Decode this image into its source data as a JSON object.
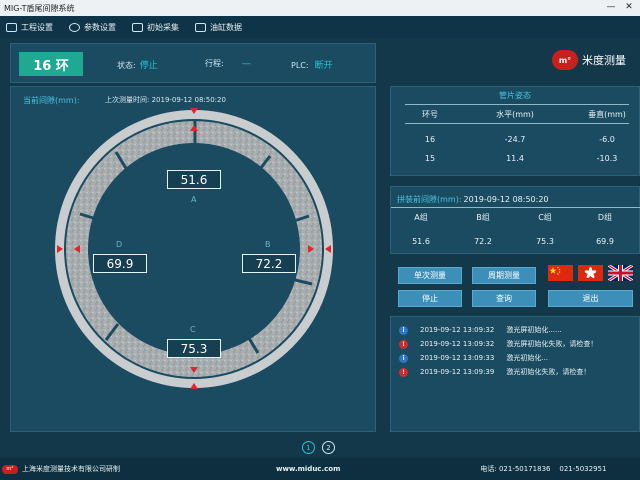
{
  "window": {
    "title": "MIG-T盾尾间隙系统",
    "minimize": "—",
    "close": "✕"
  },
  "menu": [
    {
      "label": "工程设置",
      "icon": "project-settings-icon"
    },
    {
      "label": "参数设置",
      "icon": "gear-icon"
    },
    {
      "label": "初始采集",
      "icon": "monitor-icon"
    },
    {
      "label": "油缸数据",
      "icon": "cylinder-icon"
    }
  ],
  "status": {
    "ring": "16 环",
    "state_label": "状态:",
    "state_value": "停止",
    "travel_label": "行程:",
    "travel_value": "—",
    "plc_label": "PLC:",
    "plc_value": "断开"
  },
  "logo": {
    "mark": "m°",
    "name": "米度测量"
  },
  "gap": {
    "title": "当前间隙(mm):",
    "last_time": "上次测量时间: 2019-09-12 08:50:20",
    "A": {
      "letter": "A",
      "value": "51.6"
    },
    "B": {
      "letter": "B",
      "value": "72.2"
    },
    "C": {
      "letter": "C",
      "value": "75.3"
    },
    "D": {
      "letter": "D",
      "value": "69.9"
    }
  },
  "pose": {
    "title": "管片姿态",
    "headers": [
      "环号",
      "水平(mm)",
      "垂直(mm)"
    ],
    "rows": [
      [
        "16",
        "-24.7",
        "-6.0"
      ],
      [
        "15",
        "11.4",
        "-10.3"
      ]
    ]
  },
  "assembly": {
    "title": "拼装前间隙(mm):",
    "time": "2019-09-12 08:50:20",
    "headers": [
      "A组",
      "B组",
      "C组",
      "D组"
    ],
    "values": [
      "51.6",
      "72.2",
      "75.3",
      "69.9"
    ]
  },
  "buttons": {
    "single": "单次测量",
    "periodic": "周期测量",
    "stop": "停止",
    "query": "查询",
    "exit": "退出"
  },
  "flags": {
    "cn": "china-flag-icon",
    "hk": "hongkong-flag-icon",
    "uk": "uk-flag-icon"
  },
  "log": [
    {
      "type": "info",
      "time": "2019-09-12 13:09:32",
      "msg": "激光屏初始化......"
    },
    {
      "type": "error",
      "time": "2019-09-12 13:09:32",
      "msg": "激光屏初始化失败，请检查！"
    },
    {
      "type": "info",
      "time": "2019-09-12 13:09:33",
      "msg": "激光初始化..."
    },
    {
      "type": "error",
      "time": "2019-09-12 13:09:39",
      "msg": "激光初始化失败，请检查！"
    }
  ],
  "log_icons": {
    "info": "i",
    "error": "!"
  },
  "pager": [
    "1",
    "2"
  ],
  "footer": {
    "mark": "m°",
    "company": "上海米度测量技术有限公司研制",
    "website": "www.miduc.com",
    "phone": "电话: 021-50171836    021-5032951"
  },
  "colors": {
    "accent": "#27c4d6",
    "badge": "#1fa892",
    "button": "#3b8fb8",
    "brand": "#c8201f"
  }
}
